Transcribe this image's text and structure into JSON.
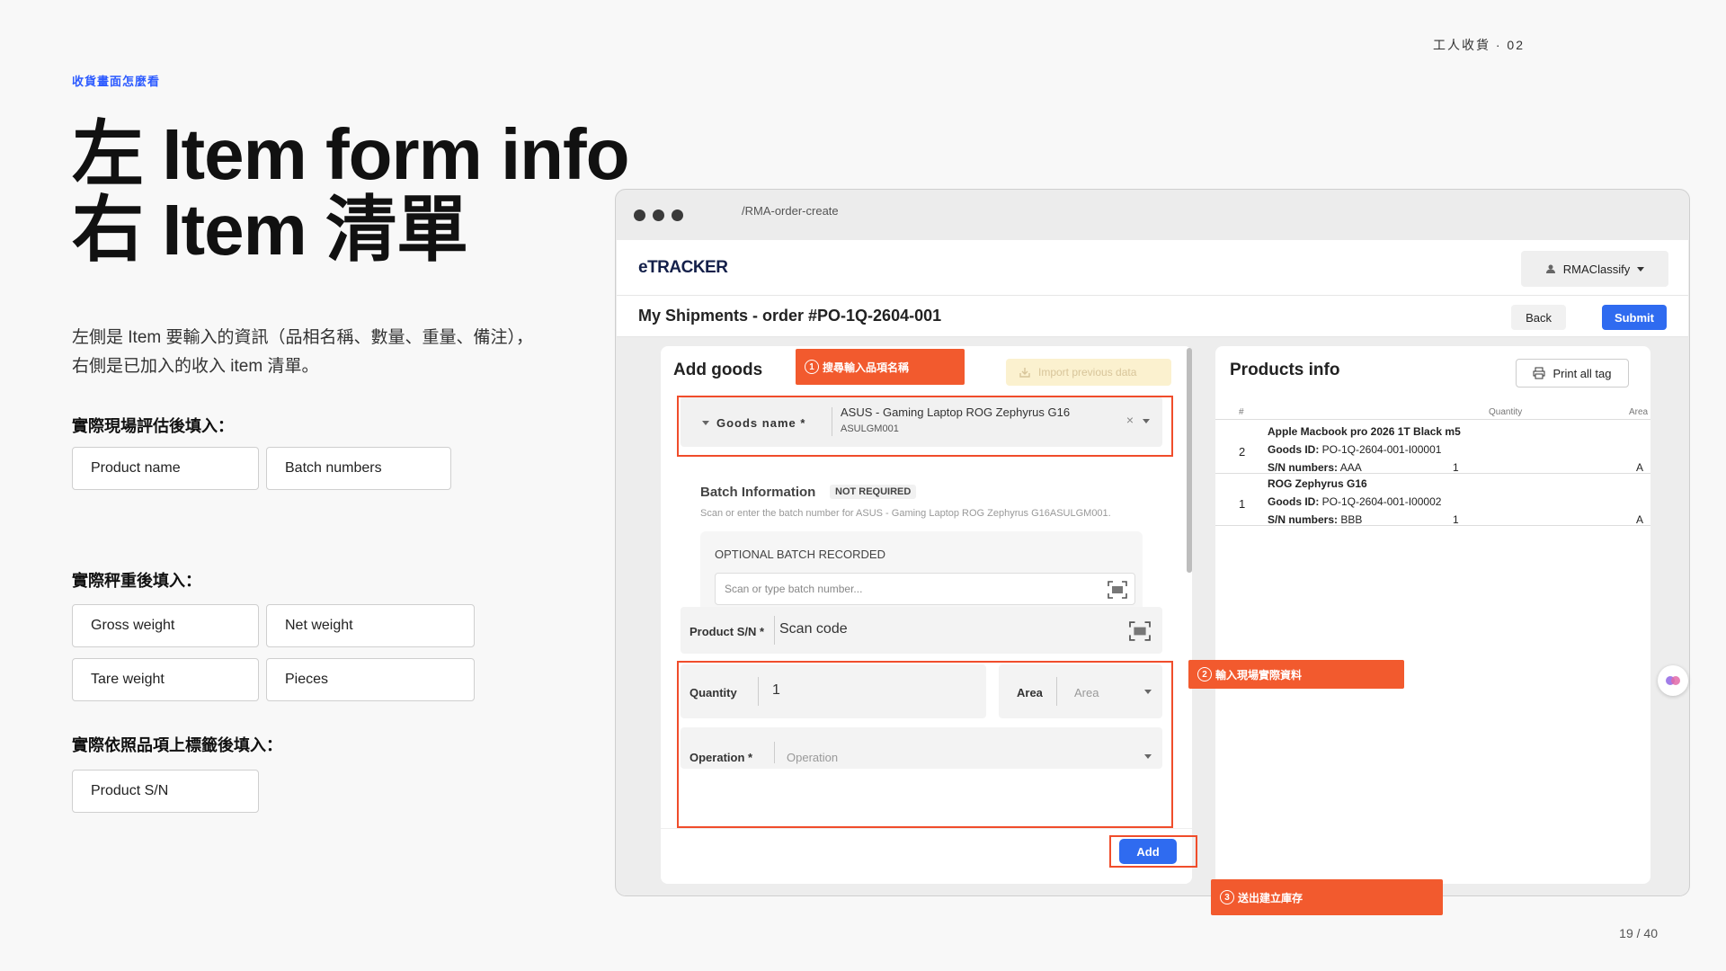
{
  "slide": {
    "tag": "收貨畫面怎麼看",
    "top_right": "工人收貨 · 02",
    "page": "19 / 40",
    "title_line1": "左 Item form info",
    "title_line2": "右 Item 清單",
    "desc_line1": "左側是 Item 要輸入的資訊（品相名稱、數量、重量、備注），",
    "desc_line2": "右側是已加入的收入 item 清單。",
    "section1_label": "實際現場評估後填入：",
    "section1_chips": [
      "Product name",
      "Batch numbers"
    ],
    "section2_label": "實際秤重後填入：",
    "section2_chips": [
      "Gross weight",
      "Net weight",
      "Tare weight",
      "Pieces"
    ],
    "section3_label": "實際依照品項上標籤後填入：",
    "section3_chips": [
      "Product S/N"
    ]
  },
  "browser": {
    "url": "/RMA-order-create"
  },
  "app": {
    "logo": "eTRACKER",
    "user_menu": "RMAClassify",
    "page_heading": "My Shipments - order #PO-1Q-2604-001",
    "back_label": "Back",
    "submit_label": "Submit",
    "add_goods": {
      "title": "Add goods",
      "import_label": "Import previous data",
      "goods_name_label": "Goods name *",
      "goods_name_value": "ASUS - Gaming Laptop ROG Zephyrus G16",
      "goods_name_sub": "ASULGM001",
      "batch_title": "Batch Information",
      "batch_badge": "NOT REQUIRED",
      "batch_note": "Scan or enter the batch number for ASUS - Gaming Laptop ROG Zephyrus G16ASULGM001.",
      "optional_batch_label": "OPTIONAL BATCH RECORDED",
      "batch_placeholder": "Scan or type batch number...",
      "sn_label": "Product S/N *",
      "sn_value": "Scan code",
      "qty_label": "Quantity",
      "qty_value": "1",
      "area_label": "Area",
      "area_placeholder": "Area",
      "operation_label": "Operation *",
      "operation_placeholder": "Operation",
      "add_label": "Add"
    },
    "products_info": {
      "title": "Products info",
      "print_label": "Print all tag",
      "columns": [
        "#",
        "Quantity",
        "Area"
      ],
      "rows": [
        {
          "num": "2",
          "name": "Apple Macbook pro 2026 1T Black m5",
          "goods_id_label": "Goods ID:",
          "goods_id": "PO-1Q-2604-001-I00001",
          "sn_label": "S/N numbers:",
          "sn": "AAA",
          "qty": "1",
          "area": "A"
        },
        {
          "num": "1",
          "name": "ROG Zephyrus G16",
          "goods_id_label": "Goods ID:",
          "goods_id": "PO-1Q-2604-001-I00002",
          "sn_label": "S/N numbers:",
          "sn": "BBB",
          "qty": "1",
          "area": "A"
        }
      ]
    }
  },
  "callouts": {
    "c1_num": "1",
    "c1": "搜尋輸入品項名稱",
    "c2_num": "2",
    "c2": "輸入現場實際資料",
    "c3_num": "3",
    "c3": "送出建立庫存"
  },
  "colors": {
    "accent": "#2f6bf0",
    "callout": "#f25a2e",
    "tag": "#2d5bff"
  }
}
